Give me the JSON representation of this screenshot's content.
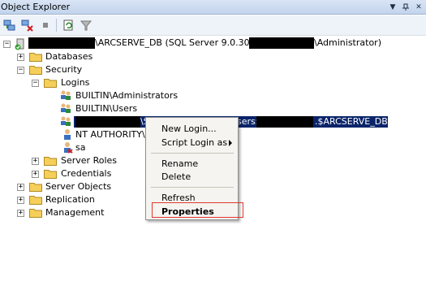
{
  "window": {
    "title": "Object Explorer",
    "controls": [
      "▾",
      "📌",
      "✕"
    ]
  },
  "toolbar": {
    "icons": [
      "connect-icon",
      "disconnect-icon",
      "stop-icon",
      "refresh-icon",
      "filter-icon"
    ]
  },
  "tree": {
    "server_suffix": "\\ARCSERVE_DB (SQL Server 9.0.3042 -",
    "server_admin": "\\Administrator)",
    "databases": "Databases",
    "security": "Security",
    "logins": "Logins",
    "login_builtin_admins": "BUILTIN\\Administrators",
    "login_builtin_users": "BUILTIN\\Users",
    "login_selected_mid": "\\S",
    "login_selected_users": "sers$",
    "login_selected_suffix": ".$ARCSERVE_DB",
    "login_nt_authority": "NT AUTHORITY\\S",
    "login_sa": "sa",
    "server_roles": "Server Roles",
    "credentials": "Credentials",
    "server_objects": "Server Objects",
    "replication": "Replication",
    "management": "Management"
  },
  "context_menu": {
    "new_login": "New Login...",
    "script_login_as": "Script Login as",
    "rename": "Rename",
    "delete": "Delete",
    "refresh": "Refresh",
    "properties": "Properties"
  },
  "colors": {
    "selection": "#0a246a",
    "highlight_box": "#e2362c",
    "folder": "#f5cf5a"
  }
}
